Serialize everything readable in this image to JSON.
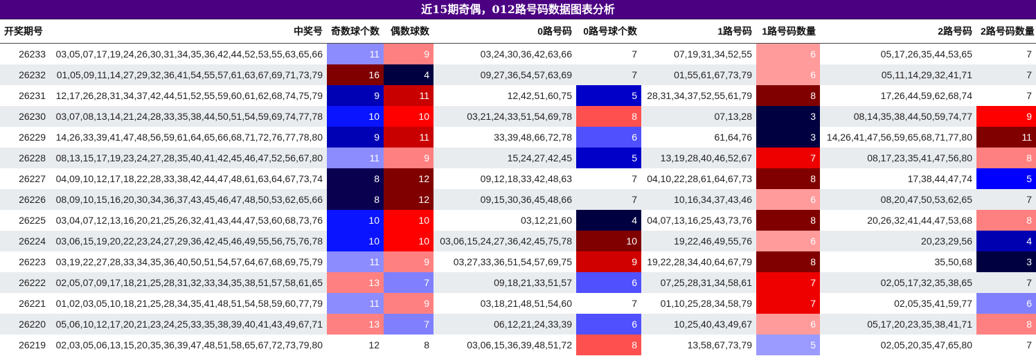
{
  "title": "近15期奇偶，012路号码数据图表分析",
  "headers": [
    "开奖期号",
    "中奖号",
    "奇数球个数",
    "偶数球数",
    "0路号码",
    "0路号球个数",
    "1路号码",
    "1路号码数量",
    "2路号码",
    "2路号码数量"
  ],
  "colors": {
    "odd_cnt": {
      "8": "#0a0050",
      "9": "#0000b4",
      "10": "#0a14ff",
      "11": "#8c8cff",
      "12": "#ffffff",
      "13": "#ff8080",
      "16": "#800000"
    },
    "even_cnt": {
      "4": "#000040",
      "7": "#8080ff",
      "8": "#ffffff",
      "9": "#ff8080",
      "10": "#ff0000",
      "11": "#c80000",
      "12": "#800000"
    },
    "r0_cnt": {
      "4": "#000040",
      "5": "#0000c8",
      "6": "#5050ff",
      "7": "#ffffff",
      "8": "#ff5050",
      "9": "#d00000",
      "10": "#800000"
    },
    "r1_cnt": {
      "3": "#000040",
      "5": "#9b9bff",
      "6": "#ff9b9b",
      "7": "#ee0000",
      "8": "#800000"
    },
    "r2_cnt": {
      "3": "#000040",
      "4": "#0000b0",
      "5": "#0000ff",
      "6": "#8080ff",
      "7": "#ffffff",
      "8": "#ff8080",
      "9": "#ff0000",
      "11": "#800000"
    }
  },
  "rows": [
    {
      "period": "26233",
      "numbers": "03,05,07,17,19,24,26,30,31,34,35,36,42,44,52,53,55,63,65,66",
      "odd_cnt": "11",
      "even_cnt": "9",
      "r0": "03,24,30,36,42,63,66",
      "r0_cnt": "7",
      "r1": "07,19,31,34,52,55",
      "r1_cnt": "6",
      "r2": "05,17,26,35,44,53,65",
      "r2_cnt": "7"
    },
    {
      "period": "26232",
      "numbers": "01,05,09,11,14,27,29,32,36,41,54,55,57,61,63,67,69,71,73,79",
      "odd_cnt": "16",
      "even_cnt": "4",
      "r0": "09,27,36,54,57,63,69",
      "r0_cnt": "7",
      "r1": "01,55,61,67,73,79",
      "r1_cnt": "6",
      "r2": "05,11,14,29,32,41,71",
      "r2_cnt": "7"
    },
    {
      "period": "26231",
      "numbers": "12,17,26,28,31,34,37,42,44,51,52,55,59,60,61,62,68,74,75,79",
      "odd_cnt": "9",
      "even_cnt": "11",
      "r0": "12,42,51,60,75",
      "r0_cnt": "5",
      "r1": "28,31,34,37,52,55,61,79",
      "r1_cnt": "8",
      "r2": "17,26,44,59,62,68,74",
      "r2_cnt": "7"
    },
    {
      "period": "26230",
      "numbers": "03,07,08,13,14,21,24,28,33,35,38,44,50,51,54,59,69,74,77,78",
      "odd_cnt": "10",
      "even_cnt": "10",
      "r0": "03,21,24,33,51,54,69,78",
      "r0_cnt": "8",
      "r1": "07,13,28",
      "r1_cnt": "3",
      "r2": "08,14,35,38,44,50,59,74,77",
      "r2_cnt": "9"
    },
    {
      "period": "26229",
      "numbers": "14,26,33,39,41,47,48,56,59,61,64,65,66,68,71,72,76,77,78,80",
      "odd_cnt": "9",
      "even_cnt": "11",
      "r0": "33,39,48,66,72,78",
      "r0_cnt": "6",
      "r1": "61,64,76",
      "r1_cnt": "3",
      "r2": "14,26,41,47,56,59,65,68,71,77,80",
      "r2_cnt": "11"
    },
    {
      "period": "26228",
      "numbers": "08,13,15,17,19,23,24,27,28,35,40,41,42,45,46,47,52,56,67,80",
      "odd_cnt": "11",
      "even_cnt": "9",
      "r0": "15,24,27,42,45",
      "r0_cnt": "5",
      "r1": "13,19,28,40,46,52,67",
      "r1_cnt": "7",
      "r2": "08,17,23,35,41,47,56,80",
      "r2_cnt": "8"
    },
    {
      "period": "26227",
      "numbers": "04,09,10,12,17,18,22,28,33,38,42,44,47,48,61,63,64,67,73,74",
      "odd_cnt": "8",
      "even_cnt": "12",
      "r0": "09,12,18,33,42,48,63",
      "r0_cnt": "7",
      "r1": "04,10,22,28,61,64,67,73",
      "r1_cnt": "8",
      "r2": "17,38,44,47,74",
      "r2_cnt": "5"
    },
    {
      "period": "26226",
      "numbers": "08,09,10,15,16,20,30,34,36,37,43,45,46,47,48,50,53,62,65,66",
      "odd_cnt": "8",
      "even_cnt": "12",
      "r0": "09,15,30,36,45,48,66",
      "r0_cnt": "7",
      "r1": "10,16,34,37,43,46",
      "r1_cnt": "6",
      "r2": "08,20,47,50,53,62,65",
      "r2_cnt": "7"
    },
    {
      "period": "26225",
      "numbers": "03,04,07,12,13,16,20,21,25,26,32,41,43,44,47,53,60,68,73,76",
      "odd_cnt": "10",
      "even_cnt": "10",
      "r0": "03,12,21,60",
      "r0_cnt": "4",
      "r1": "04,07,13,16,25,43,73,76",
      "r1_cnt": "8",
      "r2": "20,26,32,41,44,47,53,68",
      "r2_cnt": "8"
    },
    {
      "period": "26224",
      "numbers": "03,06,15,19,20,22,23,24,27,29,36,42,45,46,49,55,56,75,76,78",
      "odd_cnt": "10",
      "even_cnt": "10",
      "r0": "03,06,15,24,27,36,42,45,75,78",
      "r0_cnt": "10",
      "r1": "19,22,46,49,55,76",
      "r1_cnt": "6",
      "r2": "20,23,29,56",
      "r2_cnt": "4"
    },
    {
      "period": "26223",
      "numbers": "03,19,22,27,28,33,34,35,36,40,50,51,54,57,64,67,68,69,75,79",
      "odd_cnt": "11",
      "even_cnt": "9",
      "r0": "03,27,33,36,51,54,57,69,75",
      "r0_cnt": "9",
      "r1": "19,22,28,34,40,64,67,79",
      "r1_cnt": "8",
      "r2": "35,50,68",
      "r2_cnt": "3"
    },
    {
      "period": "26222",
      "numbers": "02,05,07,09,17,18,21,25,28,31,32,33,34,35,38,51,57,58,61,65",
      "odd_cnt": "13",
      "even_cnt": "7",
      "r0": "09,18,21,33,51,57",
      "r0_cnt": "6",
      "r1": "07,25,28,31,34,58,61",
      "r1_cnt": "7",
      "r2": "02,05,17,32,35,38,65",
      "r2_cnt": "7"
    },
    {
      "period": "26221",
      "numbers": "01,02,03,05,10,18,21,25,28,34,35,41,48,51,54,58,59,60,77,79",
      "odd_cnt": "11",
      "even_cnt": "9",
      "r0": "03,18,21,48,51,54,60",
      "r0_cnt": "7",
      "r1": "01,10,25,28,34,58,79",
      "r1_cnt": "7",
      "r2": "02,05,35,41,59,77",
      "r2_cnt": "6"
    },
    {
      "period": "26220",
      "numbers": "05,06,10,12,17,20,21,23,24,25,33,35,38,39,40,41,43,49,67,71",
      "odd_cnt": "13",
      "even_cnt": "7",
      "r0": "06,12,21,24,33,39",
      "r0_cnt": "6",
      "r1": "10,25,40,43,49,67",
      "r1_cnt": "6",
      "r2": "05,17,20,23,35,38,41,71",
      "r2_cnt": "8"
    },
    {
      "period": "26219",
      "numbers": "02,03,05,06,13,15,20,35,36,39,47,48,51,58,65,67,72,73,79,80",
      "odd_cnt": "12",
      "even_cnt": "8",
      "r0": "03,06,15,36,39,48,51,72",
      "r0_cnt": "8",
      "r1": "13,58,67,73,79",
      "r1_cnt": "5",
      "r2": "02,05,20,35,47,65,80",
      "r2_cnt": "7"
    }
  ]
}
